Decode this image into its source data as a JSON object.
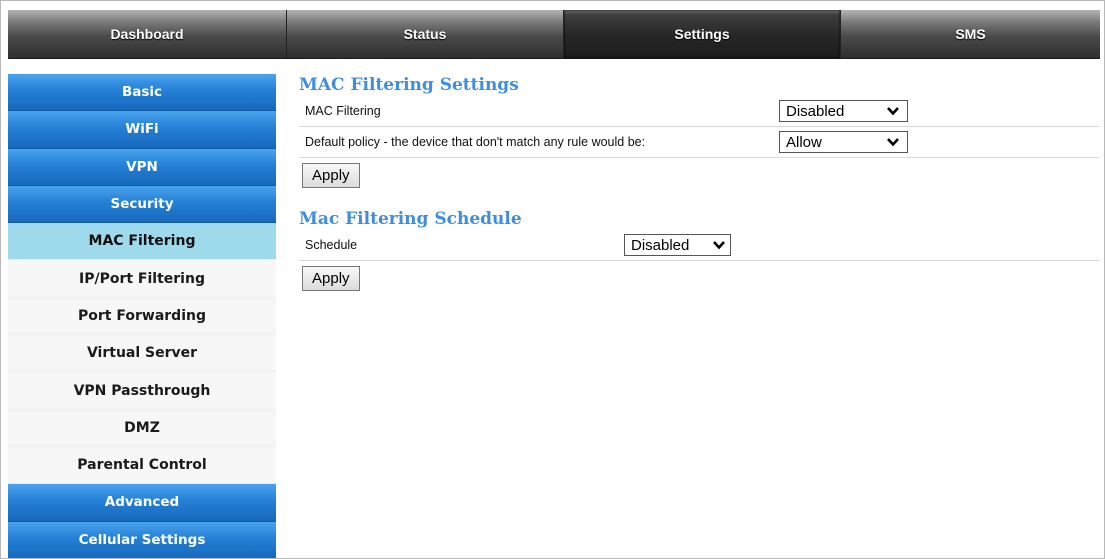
{
  "topnav": {
    "tabs": [
      {
        "label": "Dashboard"
      },
      {
        "label": "Status"
      },
      {
        "label": "Settings"
      },
      {
        "label": "SMS"
      }
    ]
  },
  "sidebar": {
    "items": [
      {
        "label": "Basic"
      },
      {
        "label": "WiFi"
      },
      {
        "label": "VPN"
      },
      {
        "label": "Security"
      },
      {
        "label": "MAC Filtering"
      },
      {
        "label": "IP/Port Filtering"
      },
      {
        "label": "Port Forwarding"
      },
      {
        "label": "Virtual Server"
      },
      {
        "label": "VPN Passthrough"
      },
      {
        "label": "DMZ"
      },
      {
        "label": "Parental Control"
      },
      {
        "label": "Advanced"
      },
      {
        "label": "Cellular Settings"
      }
    ]
  },
  "mac_settings": {
    "title": "MAC Filtering Settings",
    "filtering_label": "MAC Filtering",
    "filtering_value": "Disabled",
    "policy_label": "Default policy - the device that don't match any rule would be:",
    "policy_value": "Allow",
    "apply_label": "Apply"
  },
  "schedule": {
    "title": "Mac Filtering Schedule",
    "schedule_label": "Schedule",
    "schedule_value": "Disabled",
    "apply_label": "Apply"
  },
  "colors": {
    "accent_blue": "#2580d6",
    "selected_item": "#9fd9ec",
    "section_title": "#3d8ee0"
  }
}
